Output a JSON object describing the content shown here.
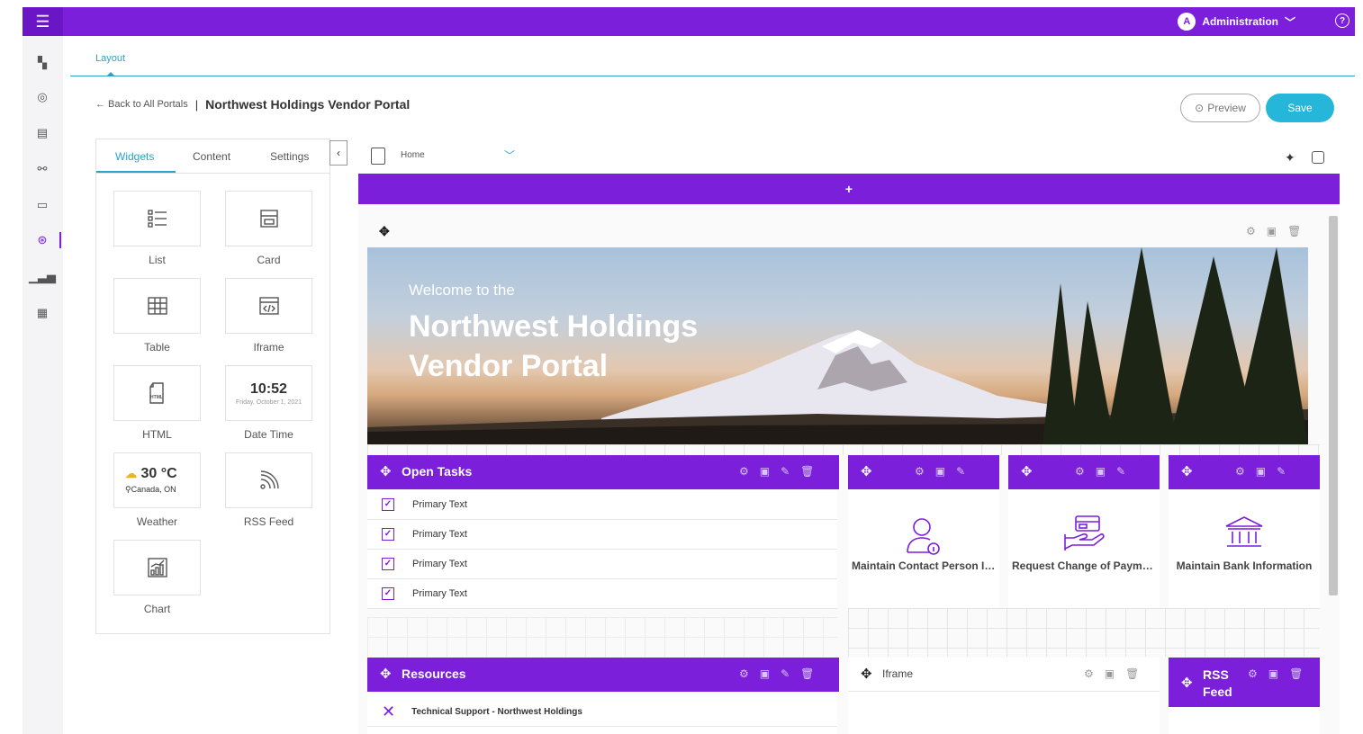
{
  "topbar": {
    "menu_icon": "hamburger-icon",
    "user_initial": "A",
    "user_label": "Administration",
    "help_icon": "?",
    "accent": "#7b1fdb"
  },
  "rail": {
    "items": [
      "dashboard-icon",
      "user-icon",
      "forms-icon",
      "workflow-icon",
      "reports-icon",
      "portal-icon",
      "chart-icon",
      "calendar-icon"
    ]
  },
  "layout_tab": "Layout",
  "breadcrumb": {
    "back": "← Back to All Portals",
    "sep": "|",
    "title": "Northwest Holdings Vendor Portal"
  },
  "actions": {
    "preview": "Preview",
    "save": "Save",
    "preview_icon": "⊙"
  },
  "panel": {
    "tabs": [
      "Widgets",
      "Content",
      "Settings"
    ],
    "collapse": "‹",
    "widgets": [
      {
        "label": "List"
      },
      {
        "label": "Card"
      },
      {
        "label": "Table"
      },
      {
        "label": "Iframe"
      },
      {
        "label": "HTML",
        "icon_text": "HTML"
      },
      {
        "label": "Date Time",
        "time": "10:52",
        "date": "Friday, October 1, 2021"
      },
      {
        "label": "Weather",
        "temp": "30 °C",
        "loc": "Canada, ON"
      },
      {
        "label": "RSS Feed"
      },
      {
        "label": "Chart"
      }
    ]
  },
  "page_select": {
    "value": "Home"
  },
  "canvas": {
    "add": "+",
    "banner": {
      "welcome": "Welcome to the",
      "line1": "Northwest Holdings",
      "line2": "Vendor Portal"
    },
    "open_tasks": {
      "title": "Open Tasks",
      "items": [
        "Primary Text",
        "Primary Text",
        "Primary Text",
        "Primary Text"
      ]
    },
    "tiles": [
      {
        "label": "Maintain Contact Person Info"
      },
      {
        "label": "Request Change of Payment..."
      },
      {
        "label": "Maintain Bank Information"
      }
    ],
    "resources": {
      "title": "Resources",
      "items": [
        "Technical Support - Northwest Holdings"
      ]
    },
    "iframe": {
      "title": "Iframe"
    },
    "rss": {
      "title_line1": "RSS",
      "title_line2": "Feed"
    }
  }
}
